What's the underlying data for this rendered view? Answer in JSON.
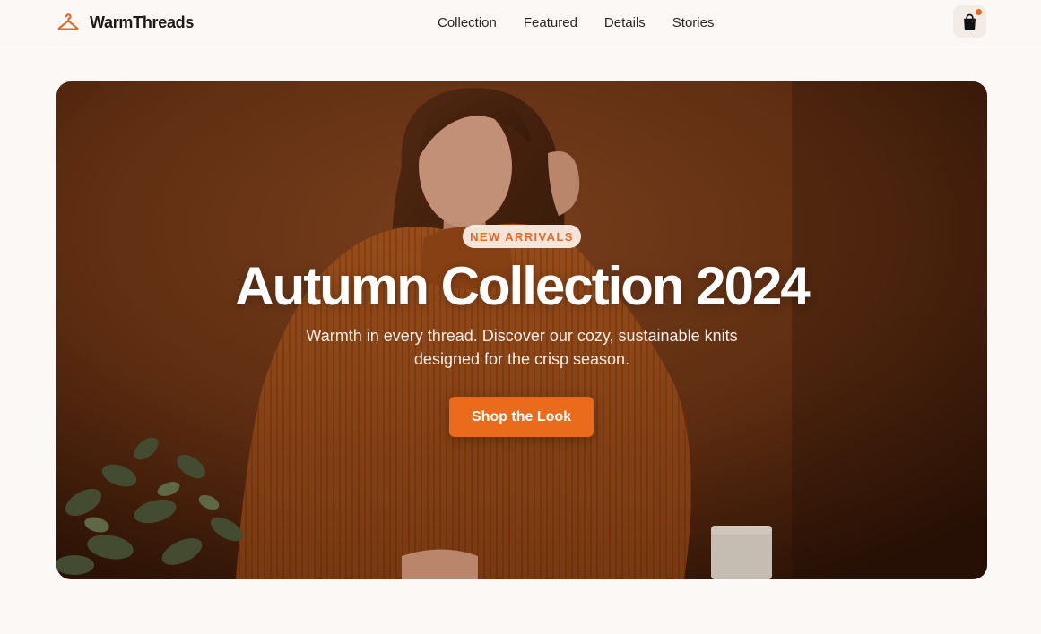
{
  "brand": {
    "name": "WarmThreads",
    "logo_icon": "hanger-icon",
    "accent_color": "#ea6b1c"
  },
  "nav": {
    "items": [
      {
        "label": "Collection"
      },
      {
        "label": "Featured"
      },
      {
        "label": "Details"
      },
      {
        "label": "Stories"
      }
    ]
  },
  "cart": {
    "icon": "shopping-bag-icon",
    "has_notification": true
  },
  "hero": {
    "badge": "NEW ARRIVALS",
    "title": "Autumn Collection 2024",
    "subtitle": "Warmth in every thread. Discover our cozy, sustainable knits designed for the crisp season.",
    "cta_label": "Shop the Look",
    "image": "woman-in-rust-sweater-photo"
  }
}
